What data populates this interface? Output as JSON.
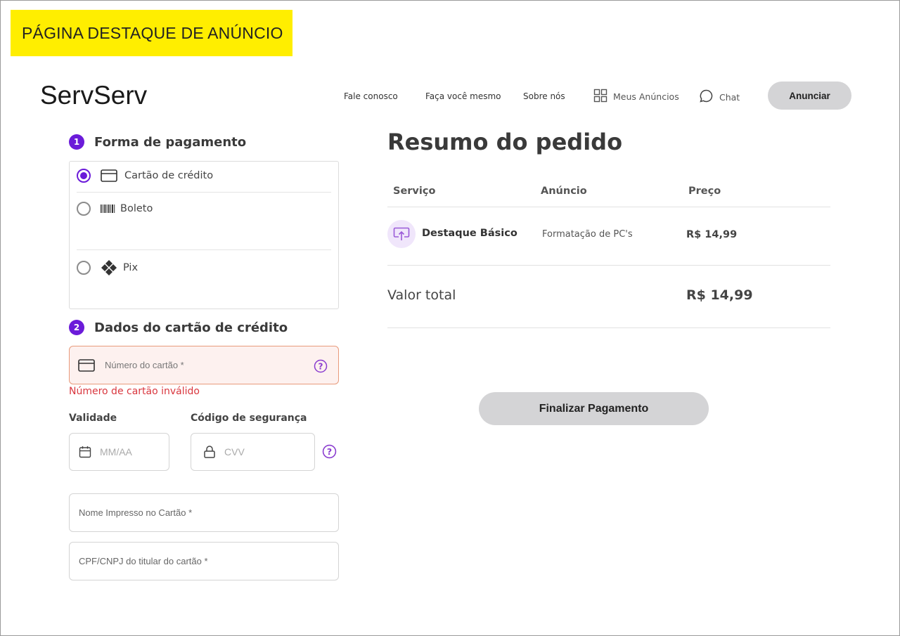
{
  "banner": {
    "title": "PÁGINA DESTAQUE DE ANÚNCIO"
  },
  "header": {
    "logo": "ServServ",
    "nav": {
      "contact": "Fale conosco",
      "diy": "Faça você mesmo",
      "about": "Sobre nós",
      "my_ads": "Meus Anúncios",
      "chat": "Chat"
    },
    "cta_label": "Anunciar"
  },
  "payment": {
    "step_number": "1",
    "title": "Forma de pagamento",
    "options": [
      {
        "label": "Cartão de crédito",
        "icon": "credit-card-icon",
        "selected": true
      },
      {
        "label": "Boleto",
        "icon": "barcode-icon",
        "selected": false
      },
      {
        "label": "Pix",
        "icon": "pix-icon",
        "selected": false
      }
    ]
  },
  "card": {
    "step_number": "2",
    "title": "Dados do cartão de crédito",
    "number_placeholder": "Número do cartão *",
    "number_error": "Número de cartão inválido",
    "expiry_label": "Validade",
    "expiry_placeholder": "MM/AA",
    "cvv_label": "Código de segurança",
    "cvv_placeholder": "CVV",
    "name_placeholder": "Nome Impresso no Cartão *",
    "document_placeholder": "CPF/CNPJ do titular do cartão *"
  },
  "summary": {
    "title": "Resumo do pedido",
    "columns": [
      "Serviço",
      "Anúncio",
      "Preço"
    ],
    "item": {
      "service": "Destaque Básico",
      "ad": "Formatação de PC's",
      "price": "R$ 14,99",
      "icon": "upload-highlight-icon"
    },
    "total_label": "Valor total",
    "total_value": "R$ 14,99",
    "submit_label": "Finalizar Pagamento"
  },
  "colors": {
    "banner": "#ffee00",
    "accent": "#6b1bd9",
    "error": "#d9363e",
    "button": "#d4d4d6"
  }
}
